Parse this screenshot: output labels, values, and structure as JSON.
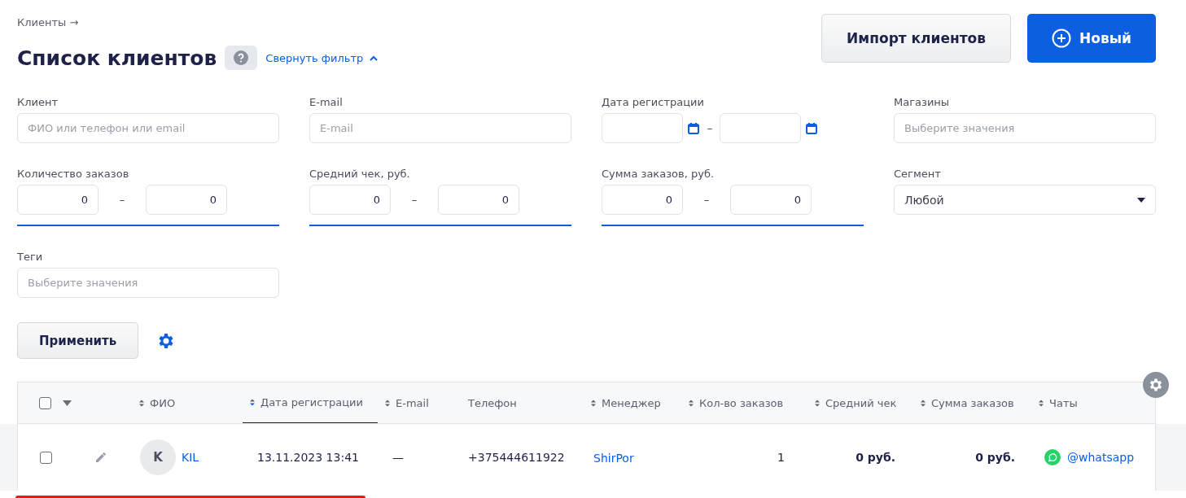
{
  "breadcrumb": {
    "label": "Клиенты",
    "arrow": "→"
  },
  "title": "Список клиентов",
  "collapse_link": "Свернуть фильтр",
  "actions": [
    {
      "label": "Импорт клиентов",
      "kind": "secondary"
    },
    {
      "label": "Новый",
      "kind": "primary"
    }
  ],
  "filters": [
    {
      "label": "Клиент",
      "kind": "text",
      "placeholder": "ФИО или телефон или email"
    },
    {
      "label": "E-mail",
      "kind": "text",
      "placeholder": "E-mail"
    },
    {
      "label": "Дата регистрации",
      "kind": "dates",
      "separator": "–"
    },
    {
      "label": "Магазины",
      "kind": "text",
      "placeholder": "Выберите значения"
    },
    {
      "label": "Количество заказов",
      "kind": "range",
      "from": "0",
      "to": "0",
      "separator": "–"
    },
    {
      "label": "Средний чек, руб.",
      "kind": "range",
      "from": "0",
      "to": "0",
      "separator": "–"
    },
    {
      "label": "Сумма заказов, руб.",
      "kind": "range",
      "from": "0",
      "to": "0",
      "separator": "–"
    },
    {
      "label": "Сегмент",
      "kind": "select",
      "value": "Любой"
    },
    {
      "label": "Теги",
      "kind": "text",
      "placeholder": "Выберите значения"
    }
  ],
  "apply_button": "Применить",
  "table": {
    "all_checked": false,
    "columns": [
      {
        "label": "ФИО",
        "sortable": true,
        "selected": false
      },
      {
        "label": "Дата регистрации",
        "sortable": true,
        "selected": true
      },
      {
        "label": "E-mail",
        "sortable": true,
        "selected": false
      },
      {
        "label": "Телефон",
        "sortable": false,
        "selected": false
      },
      {
        "label": "Менеджер",
        "sortable": true,
        "selected": false
      },
      {
        "label": "Кол-во заказов",
        "sortable": true,
        "selected": false
      },
      {
        "label": "Средний чек",
        "sortable": true,
        "selected": false
      },
      {
        "label": "Сумма заказов",
        "sortable": true,
        "selected": false
      },
      {
        "label": "Чаты",
        "sortable": true,
        "selected": false
      }
    ],
    "rows": [
      {
        "checked": false,
        "avatar": "K",
        "name": "KIL",
        "registered": "13.11.2023 13:41",
        "email": "—",
        "phone": "+375444611922",
        "manager": "ShirPor",
        "orders": "1",
        "average": "0 руб.",
        "total": "0 руб.",
        "chat": "@whatsapp",
        "highlighted": true
      }
    ]
  }
}
